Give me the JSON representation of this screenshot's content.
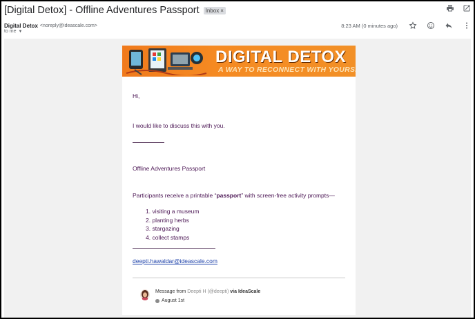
{
  "email": {
    "subject": "[Digital Detox] - Offline Adventures Passport",
    "label": "Inbox",
    "sender_name": "Digital Detox",
    "sender_email": "<noreply@ideascale.com>",
    "to_line": "to me",
    "timestamp": "8:23 AM (0 minutes ago)"
  },
  "toolbar_icons": [
    "print-icon",
    "open-in-new-window-icon",
    "star-icon",
    "emoji-icon",
    "reply-icon",
    "more-icon"
  ],
  "banner": {
    "title": "DIGITAL DETOX",
    "subtitle": "A WAY TO RECONNECT WITH YOURSELF"
  },
  "body": {
    "greeting": "Hi,",
    "intro": "I would like to discuss this with you.",
    "idea_title": "Offline Adventures Passport",
    "description_prefix": "Participants receive a printable “",
    "description_bold": "passport",
    "description_suffix": "” with screen-free activity prompts—",
    "list": [
      "visiting a museum",
      "planting herbs",
      "stargazing",
      "collect stamps"
    ],
    "link": "deepti.hawaldar@ideascale.com"
  },
  "footer": {
    "message_from": "Message from ",
    "author_handle": "Deepti H (@deepti)",
    "via": " via IdeaScale",
    "date": "August 1st"
  },
  "colors": {
    "body_text": "#4b1654",
    "link": "#1a3fa8",
    "banner_orange": "#f58a22"
  }
}
